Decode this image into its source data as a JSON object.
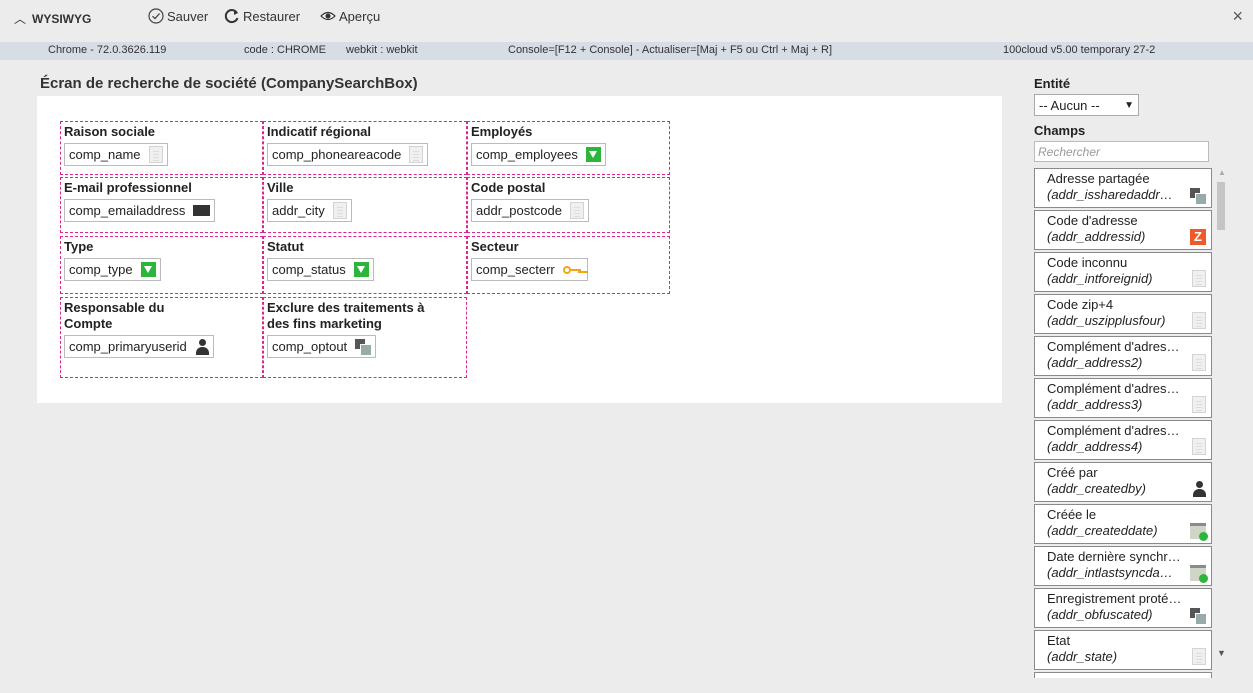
{
  "toolbar": {
    "collapse_label": "WYSIWYG",
    "save_label": "Sauver",
    "restore_label": "Restaurer",
    "preview_label": "Aperçu",
    "close_glyph": "×"
  },
  "infobar": {
    "browser": "Chrome - 72.0.3626.119",
    "code": "code : CHROME",
    "webkit": "webkit : webkit",
    "console": "Console=[F12 + Console] - Actualiser=[Maj + F5 ou Ctrl + Maj + R]",
    "version": "100cloud v5.00 temporary 27-2"
  },
  "screen": {
    "title": "Écran de recherche de société (CompanySearchBox)",
    "cells": [
      {
        "label": "Raison sociale",
        "field": "comp_name",
        "icon": "text-icon"
      },
      {
        "label": "Indicatif régional",
        "field": "comp_phoneareacode",
        "icon": "text-icon"
      },
      {
        "label": "Employés",
        "field": "comp_employees",
        "icon": "select-icon"
      },
      {
        "label": "E-mail professionnel",
        "field": "comp_emailaddress",
        "icon": "email-icon"
      },
      {
        "label": "Ville",
        "field": "addr_city",
        "icon": "text-icon"
      },
      {
        "label": "Code postal",
        "field": "addr_postcode",
        "icon": "text-icon"
      },
      {
        "label": "Type",
        "field": "comp_type",
        "icon": "select-icon"
      },
      {
        "label": "Statut",
        "field": "comp_status",
        "icon": "select-icon"
      },
      {
        "label": "Secteur",
        "field": "comp_secterr",
        "icon": "key-icon"
      },
      {
        "label": "Responsable du Compte",
        "field": "comp_primaryuserid",
        "icon": "user-icon"
      },
      {
        "label": "Exclure des traitements à des fins marketing",
        "field": "comp_optout",
        "icon": "checkbox-icon"
      }
    ]
  },
  "panel": {
    "entity_label": "Entité",
    "entity_value": "-- Aucun --",
    "fields_label": "Champs",
    "search_placeholder": "Rechercher",
    "fields": [
      {
        "label": "Adresse partagée",
        "code": "(addr_issharedaddr…",
        "icon": "checkbox-icon"
      },
      {
        "label": "Code d'adresse",
        "code": "(addr_addressid)",
        "icon": "id-icon"
      },
      {
        "label": "Code inconnu",
        "code": "(addr_intforeignid)",
        "icon": "text-icon"
      },
      {
        "label": "Code zip+4",
        "code": "(addr_uszipplusfour)",
        "icon": "text-icon"
      },
      {
        "label": "Complément d'adres…",
        "code": "(addr_address2)",
        "icon": "text-icon"
      },
      {
        "label": "Complément d'adres…",
        "code": "(addr_address3)",
        "icon": "text-icon"
      },
      {
        "label": "Complément d'adres…",
        "code": "(addr_address4)",
        "icon": "text-icon"
      },
      {
        "label": "Créé par",
        "code": "(addr_createdby)",
        "icon": "user-icon"
      },
      {
        "label": "Créée le",
        "code": "(addr_createddate)",
        "icon": "calendar-icon"
      },
      {
        "label": "Date dernière synchr…",
        "code": "(addr_intlastsyncda…",
        "icon": "calendar-icon"
      },
      {
        "label": "Enregistrement proté…",
        "code": "(addr_obfuscated)",
        "icon": "checkbox-icon"
      },
      {
        "label": "Etat",
        "code": "(addr_state)",
        "icon": "text-icon"
      }
    ]
  },
  "colors": {
    "cell_border": "#d9278f",
    "select_green": "#2bb53b",
    "key_orange": "#f3a519",
    "id_orange": "#ee5b2b",
    "infobar_bg": "#d6dde4"
  }
}
